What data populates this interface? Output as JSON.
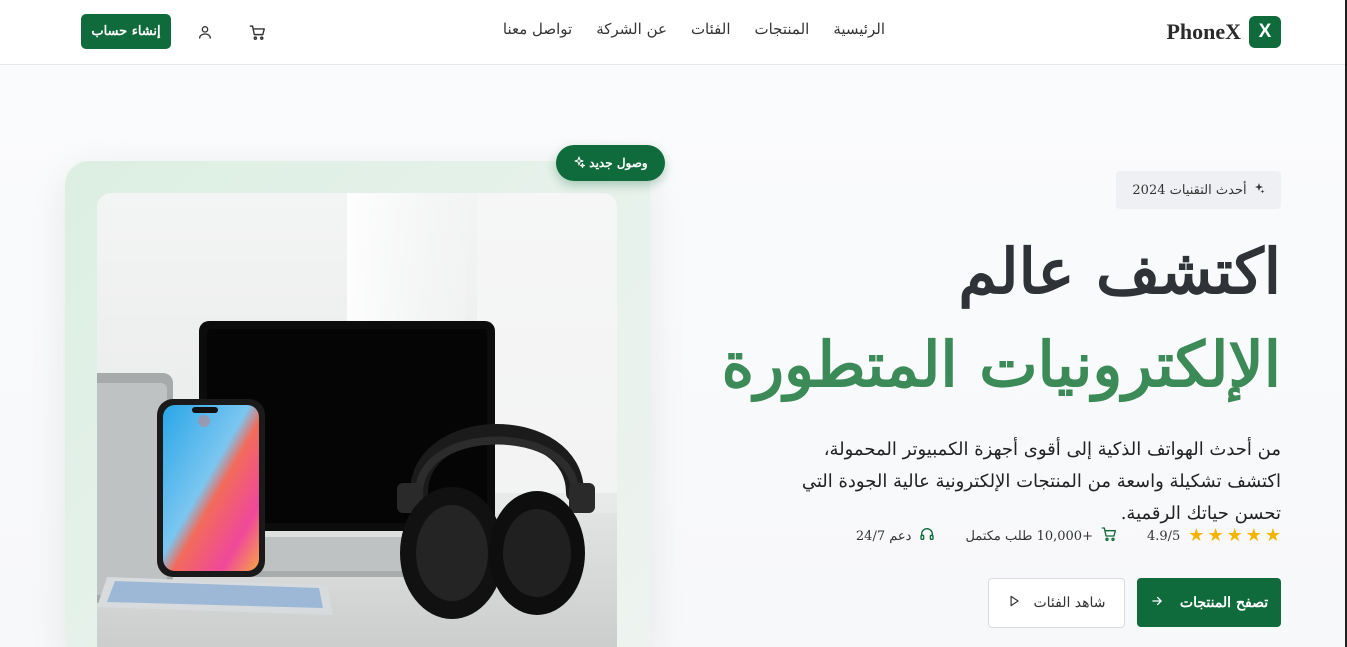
{
  "brand": {
    "name": "PhoneX",
    "mark": "X"
  },
  "nav": {
    "items": [
      "الرئيسية",
      "المنتجات",
      "الفئات",
      "عن الشركة",
      "تواصل معنا"
    ]
  },
  "header": {
    "signup_label": "إنشاء حساب"
  },
  "hero": {
    "badge": "أحدث التقنيات 2024",
    "headline_line1": "اكتشف عالم",
    "headline_line2": "الإلكترونيات المتطورة",
    "lead": "من أحدث الهواتف الذكية إلى أقوى أجهزة الكمبيوتر المحمولة، اكتشف تشكيلة واسعة من المنتجات الإلكترونية عالية الجودة التي تحسن حياتك الرقمية.",
    "rating": {
      "stars": 5,
      "text": "4.9/5"
    },
    "orders": "+10,000 طلب مكتمل",
    "support": "دعم 24/7",
    "primary_cta": "تصفح المنتجات",
    "secondary_cta": "شاهد الفئات",
    "new_badge": "وصول جديد"
  },
  "colors": {
    "brand_green": "#0f6b3b",
    "headline_green": "#3c8a58",
    "star": "#f4b400"
  },
  "icons": {
    "sparkles": "sparkles-icon",
    "cart": "cart-icon",
    "user": "user-icon",
    "headphones": "headphones-icon",
    "arrow": "arrow-right-icon",
    "play": "play-icon",
    "star": "star-icon"
  }
}
